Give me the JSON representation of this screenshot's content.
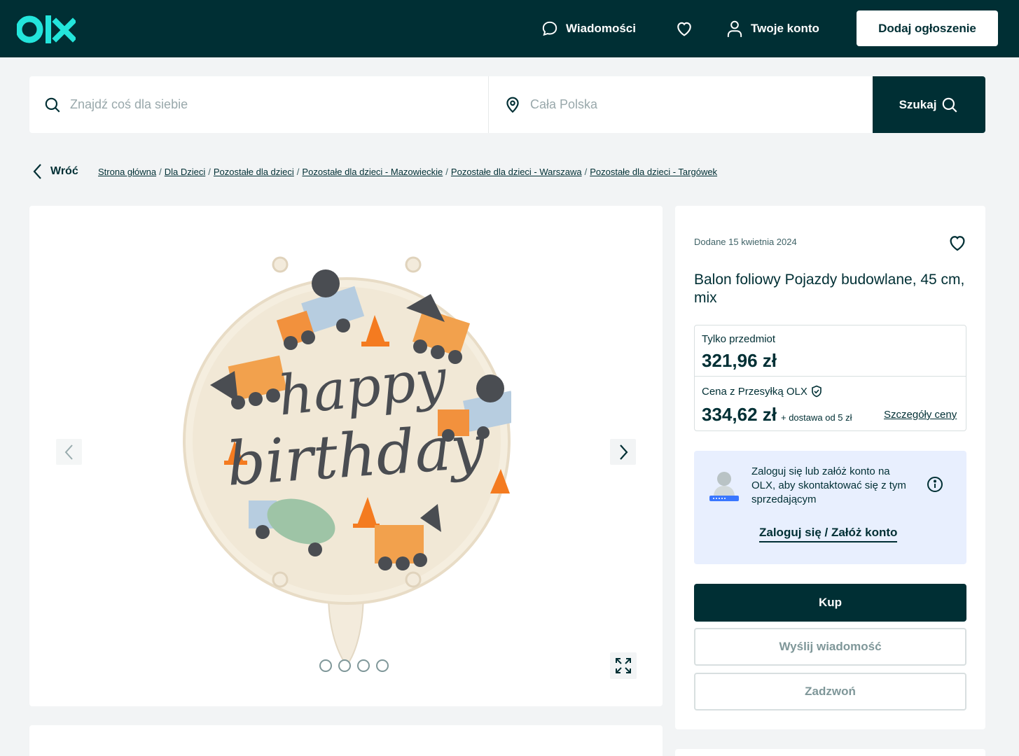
{
  "header": {
    "logo_text": "olx",
    "messages_label": "Wiadomości",
    "account_label": "Twoje konto",
    "add_listing_label": "Dodaj ogłoszenie"
  },
  "search": {
    "query_placeholder": "Znajdź coś dla siebie",
    "location_placeholder": "Cała Polska",
    "button_label": "Szukaj"
  },
  "breadcrumb": {
    "back_label": "Wróć",
    "items": [
      "Strona główna",
      "Dla Dzieci",
      "Pozostałe dla dzieci",
      "Pozostałe dla dzieci - Mazowieckie",
      "Pozostałe dla dzieci - Warszawa",
      "Pozostałe dla dzieci - Targówek"
    ]
  },
  "gallery": {
    "image_text_line1": "happy",
    "image_text_line2": "birthday",
    "total_images": 4,
    "active_index": 0
  },
  "listing": {
    "added_date": "Dodane 15 kwietnia 2024",
    "title": "Balon foliowy Pojazdy budowlane, 45 cm, mix",
    "item_only_label": "Tylko przedmiot",
    "item_only_price": "321,96 zł",
    "with_shipping_label": "Cena z Przesyłką OLX",
    "with_shipping_price": "334,62 zł",
    "shipping_note": "+ dostawa od 5 zł",
    "price_details_link": "Szczegóły ceny"
  },
  "login_prompt": {
    "text": "Zaloguj się lub załóż konto na OLX, aby skontaktować się z tym sprzedającym",
    "link_label": "Zaloguj się / Załóż konto"
  },
  "actions": {
    "buy_label": "Kup",
    "message_label": "Wyślij wiadomość",
    "call_label": "Zadzwoń"
  },
  "colors": {
    "brand_dark": "#002f34",
    "brand_teal": "#23e5db",
    "page_bg": "#f2f4f5",
    "login_bg": "#e8effe"
  }
}
